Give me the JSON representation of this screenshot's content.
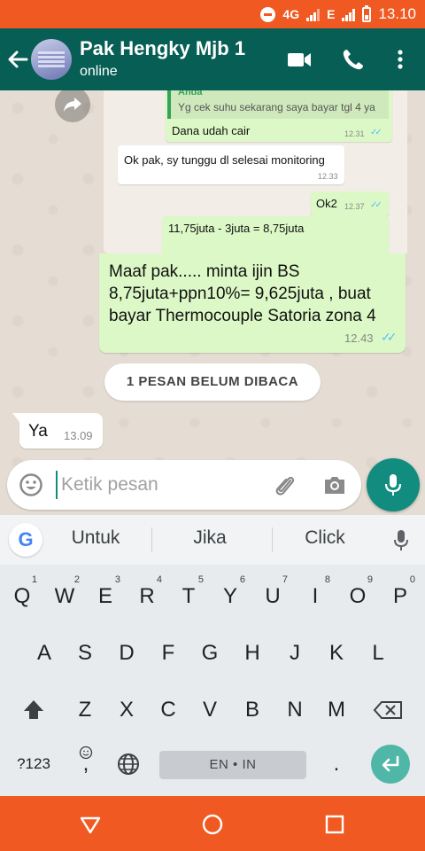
{
  "status_bar": {
    "network": "4G",
    "network2": "E",
    "time": "13.10"
  },
  "header": {
    "contact_name": "Pak Hengky Mjb 1",
    "contact_status": "online"
  },
  "forwarded": {
    "quote_author": "Anda",
    "quote_text": "Yg cek suhu sekarang saya bayar tgl 4 ya",
    "msg1_text": "Dana udah cair",
    "msg1_time": "12.31",
    "msg2_text": "Ok pak, sy tunggu dl selesai monitoring",
    "msg2_time": "12.33",
    "msg3_text": "Ok2",
    "msg3_time": "12.37",
    "msg4_text": "11,75juta - 3juta = 8,75juta"
  },
  "messages": {
    "outgoing_text": "Maaf pak..... minta ijin BS 8,75juta+ppn10%= 9,625juta , buat bayar Thermocouple Satoria zona 4",
    "outgoing_time": "12.43",
    "unread_banner": "1 PESAN BELUM DIBACA",
    "incoming_text": "Ya",
    "incoming_time": "13.09"
  },
  "composer": {
    "placeholder": "Ketik pesan"
  },
  "keyboard": {
    "suggestions": [
      "Untuk",
      "Jika",
      "Click"
    ],
    "row1": [
      "Q",
      "W",
      "E",
      "R",
      "T",
      "Y",
      "U",
      "I",
      "O",
      "P"
    ],
    "row1_hints": [
      "1",
      "2",
      "3",
      "4",
      "5",
      "6",
      "7",
      "8",
      "9",
      "0"
    ],
    "row2": [
      "A",
      "S",
      "D",
      "F",
      "G",
      "H",
      "J",
      "K",
      "L"
    ],
    "row3": [
      "Z",
      "X",
      "C",
      "V",
      "B",
      "N",
      "M"
    ],
    "symbols_key": "?123",
    "comma_key": ",",
    "space_label": "EN • IN",
    "period_key": "."
  },
  "colors": {
    "header": "#075e54",
    "system_bar": "#f05a22",
    "accent": "#128c7e",
    "bubble_out": "#dcf8c6",
    "read_tick": "#4fc3f7"
  }
}
